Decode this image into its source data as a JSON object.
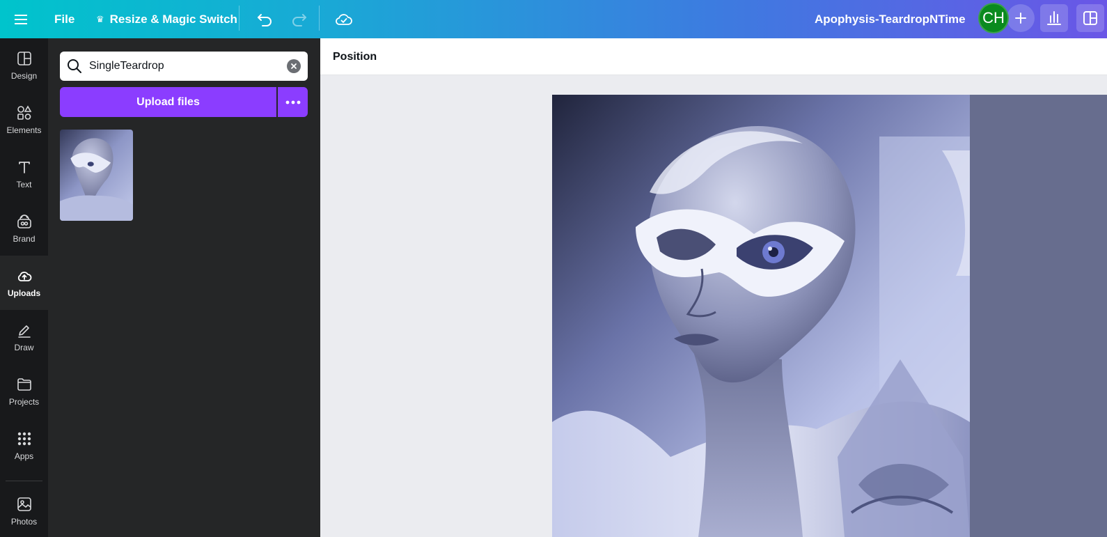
{
  "topbar": {
    "file_label": "File",
    "resize_label": "Resize & Magic Switch",
    "document_title": "Apophysis-TeardropNTime",
    "avatar_initials": "CH",
    "gradient_start": "#00c4cc",
    "gradient_end": "#6a56e6"
  },
  "rail": {
    "items": [
      {
        "label": "Design",
        "icon": "design-icon"
      },
      {
        "label": "Elements",
        "icon": "elements-icon"
      },
      {
        "label": "Text",
        "icon": "text-icon"
      },
      {
        "label": "Brand",
        "icon": "brand-icon"
      },
      {
        "label": "Uploads",
        "icon": "uploads-icon",
        "active": true
      },
      {
        "label": "Draw",
        "icon": "draw-icon"
      },
      {
        "label": "Projects",
        "icon": "projects-icon"
      },
      {
        "label": "Apps",
        "icon": "apps-icon"
      },
      {
        "label": "Photos",
        "icon": "photos-icon"
      }
    ]
  },
  "panel": {
    "search_value": "SingleTeardrop",
    "upload_label": "Upload files",
    "accent": "#8b3dff"
  },
  "context_toolbar": {
    "position_label": "Position"
  }
}
